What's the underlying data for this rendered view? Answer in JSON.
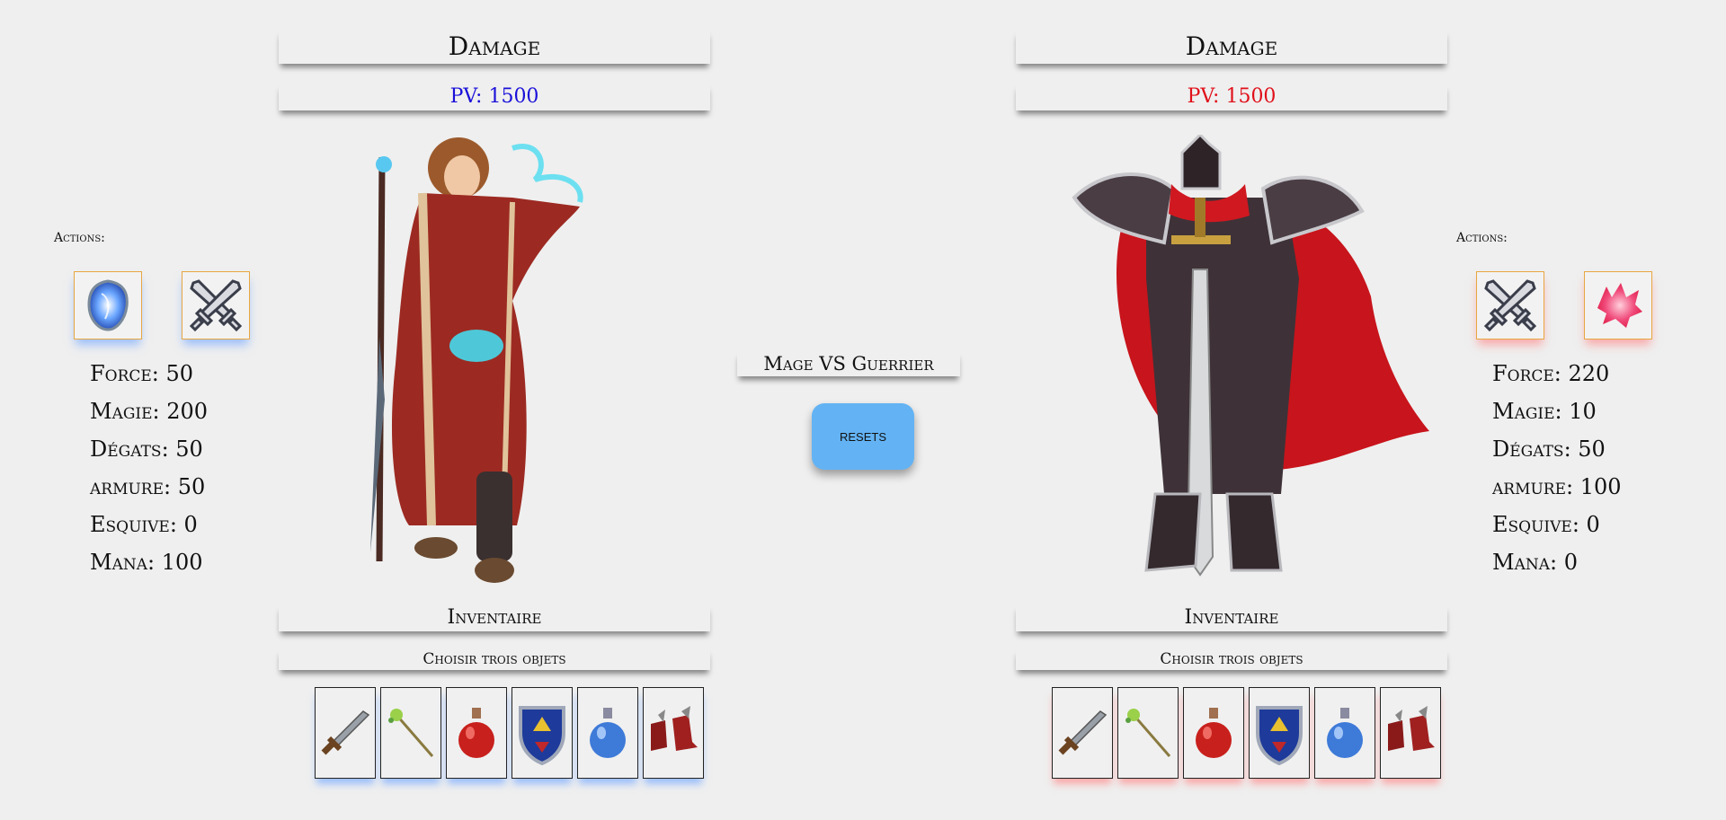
{
  "match_title": "Mage VS Guerrier",
  "reset_label": "RESETS",
  "actions_label": "Actions:",
  "left": {
    "damage_title": "Damage",
    "pv": "PV: 1500",
    "inventory_title": "Inventaire",
    "choose_label": "Choisir trois objets",
    "stats": {
      "force": "Force: 50",
      "magie": "Magie: 200",
      "degats": "Dégats: 50",
      "armure": "armure: 50",
      "esquive": "Esquive: 0",
      "mana": "Mana: 100"
    },
    "actions": [
      "magic-shield-icon",
      "crossed-swords-icon"
    ]
  },
  "right": {
    "damage_title": "Damage",
    "pv": "PV: 1500",
    "inventory_title": "Inventaire",
    "choose_label": "Choisir trois objets",
    "stats": {
      "force": "Force: 220",
      "magie": "Magie: 10",
      "degats": "Dégats: 50",
      "armure": "armure: 100",
      "esquive": "Esquive: 0",
      "mana": "Mana: 0"
    },
    "actions": [
      "crossed-swords-icon",
      "rage-wolf-icon"
    ]
  },
  "inventory_items": [
    "sword-icon",
    "staff-icon",
    "red-potion-icon",
    "shield-icon",
    "blue-potion-icon",
    "boots-icon"
  ],
  "colors": {
    "player_one": "#1a10d8",
    "player_two": "#e0101a",
    "reset_button": "#63b3f4"
  }
}
